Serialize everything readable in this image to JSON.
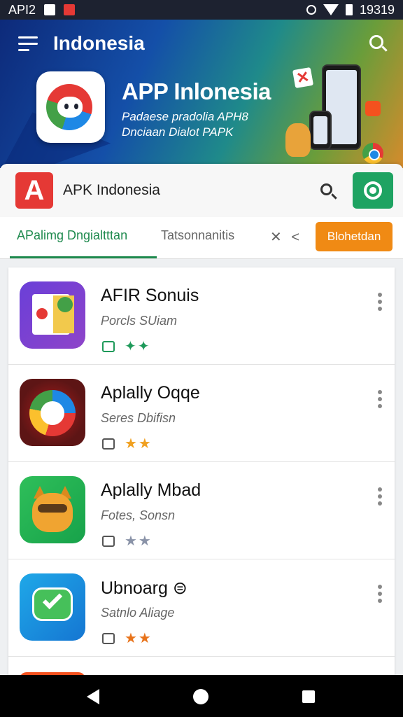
{
  "status_bar": {
    "left_text": "API2",
    "time": "19319"
  },
  "header": {
    "title": "Indonesia",
    "app_name": "APP Inlonesia",
    "app_subtitle_line1": "Padaese pradolia APH8",
    "app_subtitle_line2": "Dnciaan Dialot PAPK"
  },
  "search": {
    "logo_letter": "A",
    "text": "APK Indonesia"
  },
  "tabs": {
    "tab1": "APalimg Dngialtttan",
    "tab2": "Tatsonnanitis",
    "tab3": "✕ <",
    "action_button": "Blohetdan"
  },
  "apps": [
    {
      "title": "AFIR Sonuis",
      "subtitle": "Porcls SUiam",
      "meta": "✦✦",
      "star_color": "#1e9a5a",
      "icon": "puzzle-app-icon"
    },
    {
      "title": "Aplally Oqqe",
      "subtitle": "Seres Dbifisn",
      "meta": "★★",
      "star_color": "#f0a020",
      "icon": "browser-ring-icon"
    },
    {
      "title": "Aplally Mbad",
      "subtitle": "Fotes, Sonsn",
      "meta": "★★",
      "star_color": "#8a93a8",
      "icon": "cat-mascot-icon"
    },
    {
      "title": "Ubnoarg ⊜",
      "subtitle": "Satnlo Aliage",
      "meta": "★★",
      "star_color": "#e8731a",
      "icon": "chat-check-icon"
    }
  ]
}
